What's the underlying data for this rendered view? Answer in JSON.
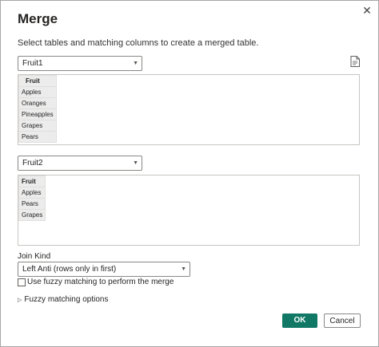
{
  "dialog": {
    "title": "Merge",
    "subtitle": "Select tables and matching columns to create a merged table."
  },
  "table1": {
    "selected": "Fruit1",
    "header": "Fruit",
    "rows": [
      "Apples",
      "Oranges",
      "Pineapples",
      "Grapes",
      "Pears"
    ]
  },
  "table2": {
    "selected": "Fruit2",
    "header": "Fruit",
    "rows": [
      "Apples",
      "Pears",
      "Grapes"
    ]
  },
  "join": {
    "label": "Join Kind",
    "selected": "Left Anti (rows only in first)"
  },
  "fuzzy": {
    "checkbox_label": "Use fuzzy matching to perform the merge",
    "checked": false,
    "options_label": "Fuzzy matching options"
  },
  "buttons": {
    "ok": "OK",
    "cancel": "Cancel"
  },
  "colors": {
    "ok_button": "#117865",
    "grid_cell": "#ececec"
  },
  "icons": {
    "close": "close-icon",
    "dropdown": "chevron-down-icon",
    "document": "document-icon",
    "expand": "triangle-right-icon"
  }
}
